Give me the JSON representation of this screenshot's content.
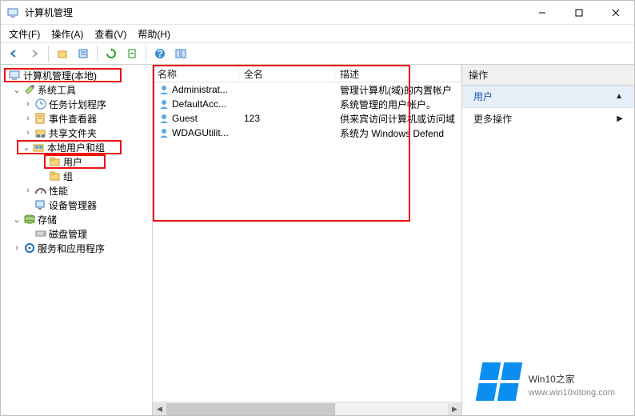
{
  "title": "计算机管理",
  "menu": {
    "file": "文件(F)",
    "action": "操作(A)",
    "view": "查看(V)",
    "help": "帮助(H)"
  },
  "tree": {
    "root": "计算机管理(本地)",
    "systools": "系统工具",
    "tasksched": "任务计划程序",
    "eventvwr": "事件查看器",
    "sharedfld": "共享文件夹",
    "localusrgrp": "本地用户和组",
    "users": "用户",
    "groups": "组",
    "perf": "性能",
    "devmgr": "设备管理器",
    "storage": "存储",
    "diskmgmt": "磁盘管理",
    "services": "服务和应用程序"
  },
  "list": {
    "cols": {
      "name": "名称",
      "fullname": "全名",
      "desc": "描述"
    },
    "rows": [
      {
        "name": "Administrat...",
        "fullname": "",
        "desc": "管理计算机(域)的内置帐户"
      },
      {
        "name": "DefaultAcc...",
        "fullname": "",
        "desc": "系统管理的用户帐户。"
      },
      {
        "name": "Guest",
        "fullname": "123",
        "desc": "供来宾访问计算机或访问域"
      },
      {
        "name": "WDAGUtilit...",
        "fullname": "",
        "desc": "系统为 Windows Defend"
      }
    ]
  },
  "actions": {
    "header": "操作",
    "users": "用户",
    "more": "更多操作"
  },
  "watermark": {
    "brand": "Win10",
    "suffix": "之家",
    "url": "www.win10xitong.com"
  }
}
